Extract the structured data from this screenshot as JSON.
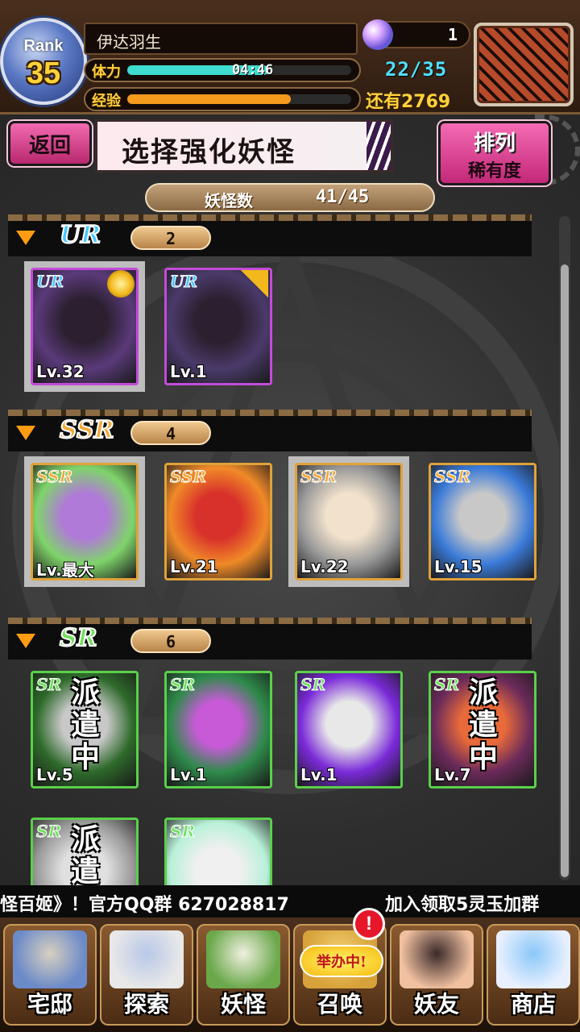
{
  "player": {
    "rank_label": "Rank",
    "rank": "35",
    "name": "伊达羽生",
    "stamina_label": "体力",
    "stamina_timer": "04:46",
    "stamina_value": "22/35",
    "stamina_fraction": 0.63,
    "exp_label": "经验",
    "exp_fraction": 0.73,
    "exp_remaining": "还有2769",
    "orb_count": "1"
  },
  "header": {
    "back_label": "返回",
    "title": "选择强化妖怪",
    "sort_title": "排列",
    "sort_value": "稀有度"
  },
  "monster_count": {
    "label": "妖怪数",
    "value": "41/45"
  },
  "groups": [
    {
      "rarity": "UR",
      "count": "2",
      "color": "#47c8ff",
      "cards": [
        {
          "level": "Lv.32",
          "tag": "UR",
          "selected": true,
          "badge": "gold-medal-icon",
          "palette": [
            "#5a3a7a",
            "#2c2030"
          ]
        },
        {
          "level": "Lv.1",
          "tag": "UR",
          "selected": false,
          "badge": "star-corner-icon",
          "palette": [
            "#4a3a6a",
            "#2c2030"
          ]
        }
      ]
    },
    {
      "rarity": "SSR",
      "count": "4",
      "color": "#f2a93b",
      "cards": [
        {
          "level": "Lv.最大",
          "tag": "SSR",
          "selected": true,
          "palette": [
            "#7fd46a",
            "#b07ad8"
          ]
        },
        {
          "level": "Lv.21",
          "tag": "SSR",
          "selected": false,
          "palette": [
            "#f08a28",
            "#d8302a"
          ]
        },
        {
          "level": "Lv.22",
          "tag": "SSR",
          "selected": true,
          "palette": [
            "#9a9a9a",
            "#f2e2cc"
          ]
        },
        {
          "level": "Lv.15",
          "tag": "SSR",
          "selected": false,
          "palette": [
            "#3a7ad8",
            "#c8c8c8"
          ]
        }
      ]
    },
    {
      "rarity": "SR",
      "count": "6",
      "color": "#6fe05a",
      "cards": [
        {
          "level": "Lv.5",
          "tag": "SR",
          "selected": false,
          "dispatch": "派遣中",
          "palette": [
            "#2e6a2a",
            "#c8c8c8"
          ]
        },
        {
          "level": "Lv.1",
          "tag": "SR",
          "selected": false,
          "palette": [
            "#2e8a4a",
            "#c85ad8"
          ]
        },
        {
          "level": "Lv.1",
          "tag": "SR",
          "selected": false,
          "palette": [
            "#7a2ad8",
            "#e8e8e8"
          ]
        },
        {
          "level": "Lv.7",
          "tag": "SR",
          "selected": false,
          "dispatch": "派遣中",
          "palette": [
            "#6a2a5a",
            "#e86a3a"
          ]
        },
        {
          "level": "",
          "tag": "SR",
          "selected": false,
          "dispatch": "派遣",
          "palette": [
            "#9a9a9a",
            "#e0e0e0"
          ]
        },
        {
          "level": "",
          "tag": "SR",
          "selected": false,
          "palette": [
            "#b8f0d8",
            "#f0f0f0"
          ]
        }
      ]
    }
  ],
  "ticker": {
    "left": "怪百姬》！官方QQ群 627028817",
    "right": "加入领取5灵玉加群"
  },
  "nav": {
    "items": [
      {
        "label": "宅邸",
        "icon": "mansion-icon",
        "art": [
          "#6b8ac8",
          "#d8d0c0"
        ]
      },
      {
        "label": "探索",
        "icon": "magnifier-map-icon",
        "art": [
          "#e8e8e8",
          "#b8c8e8"
        ]
      },
      {
        "label": "妖怪",
        "icon": "scroll-icon",
        "art": [
          "#6aa84a",
          "#f0f0e0"
        ]
      },
      {
        "label": "召唤",
        "icon": "summon-icon",
        "art": [
          "#d8a23a",
          "#f0d070"
        ]
      },
      {
        "label": "妖友",
        "icon": "friend-icon",
        "art": [
          "#f0c0a0",
          "#3a2a2a"
        ]
      },
      {
        "label": "商店",
        "icon": "crystal-ball-icon",
        "art": [
          "#e8f0ff",
          "#8ac8f8"
        ]
      }
    ],
    "alert_badge": "!",
    "event_tag": "举办中!"
  },
  "colors": {
    "stamina_fill": "#3fdcd0",
    "exp_fill": "#f49a1c",
    "accent_pink": "#e64b9c"
  }
}
